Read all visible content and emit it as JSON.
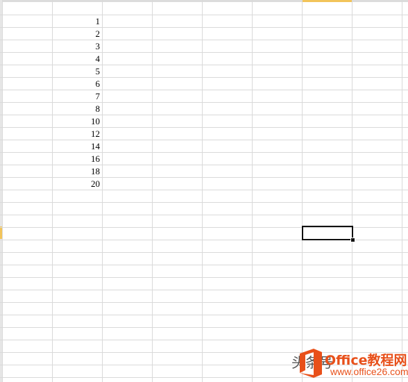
{
  "sheet": {
    "column_values": [
      "1",
      "2",
      "3",
      "4",
      "5",
      "6",
      "7",
      "8",
      "10",
      "12",
      "14",
      "16",
      "18",
      "20"
    ]
  },
  "watermark": {
    "chinese_prefix": "头条号",
    "brand": "Office教程网",
    "url": "www.office26.com"
  },
  "colors": {
    "gridline": "#d9d9d9",
    "header_highlight": "#f2c45a",
    "brand": "#e8501a"
  }
}
